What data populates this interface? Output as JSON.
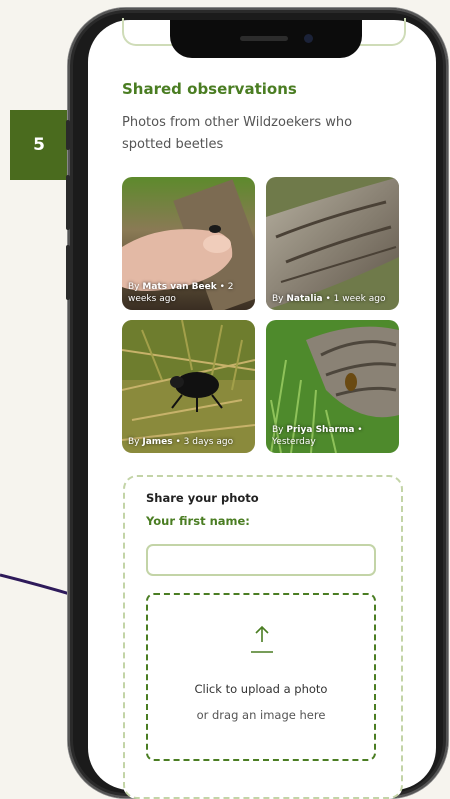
{
  "step_badge": "5",
  "section": {
    "title": "Shared observations",
    "subtitle": "Photos from other Wildzoekers who spotted beetles"
  },
  "photos": [
    {
      "prefix": "By ",
      "author": "Mats van Beek",
      "suffix": " • 2 weeks ago",
      "subject": "beetle-on-finger"
    },
    {
      "prefix": "By ",
      "author": "Natalia",
      "suffix": " • 1 week ago",
      "subject": "log-bark"
    },
    {
      "prefix": "By ",
      "author": "James",
      "suffix": " • 3 days ago",
      "subject": "black-beetle-on-grass"
    },
    {
      "prefix": "By ",
      "author": "Priya Sharma",
      "suffix": " • Yesterday",
      "subject": "beetle-on-log-in-grass"
    }
  ],
  "upload": {
    "title": "Share your photo",
    "name_label": "Your first name:",
    "name_value": "",
    "name_placeholder": "",
    "drop_line1": "Click to upload a photo",
    "drop_line2": "or drag an image here",
    "icon": "upload-arrow-icon"
  },
  "colors": {
    "accent_green": "#4a7d22",
    "badge_green": "#4a6b1e",
    "light_green_border": "#c3d4a7",
    "connector_purple": "#2e1a5a"
  }
}
